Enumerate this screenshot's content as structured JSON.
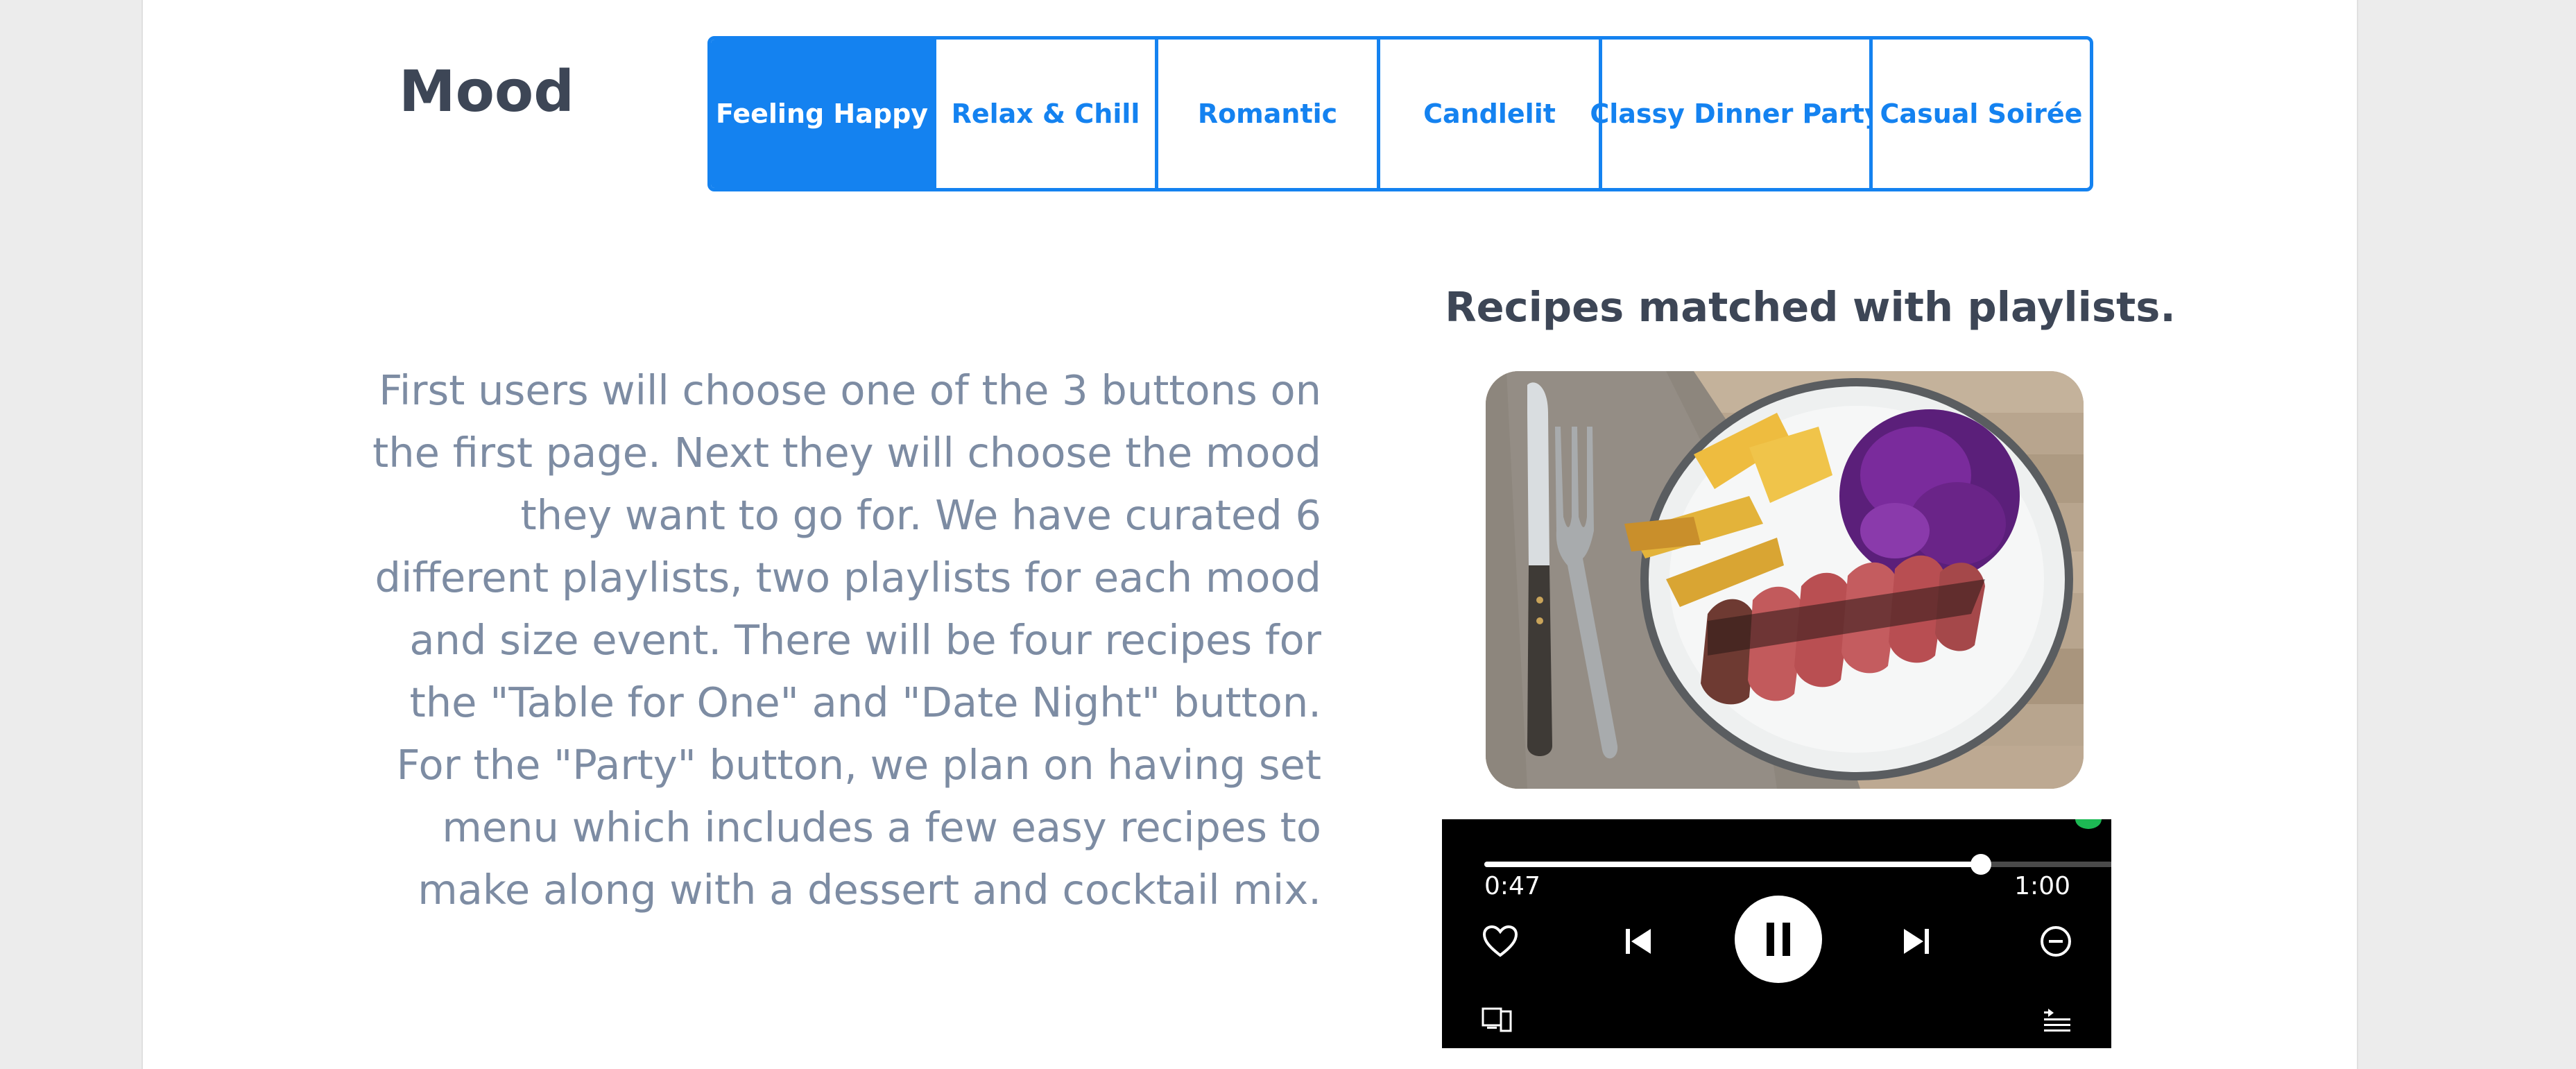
{
  "mood": {
    "title": "Mood",
    "tabs": [
      {
        "label": "Feeling Happy",
        "active": true
      },
      {
        "label": "Relax & Chill",
        "active": false
      },
      {
        "label": "Romantic",
        "active": false
      },
      {
        "label": "Candlelit",
        "active": false
      },
      {
        "label": "Classy Dinner Party",
        "active": false
      },
      {
        "label": "Casual Soirée",
        "active": false
      }
    ]
  },
  "description": "First users will choose one of the 3 buttons on the first page. Next they will choose the mood they want to go for. We have curated 6 different playlists, two playlists for each mood and size event. There will be four recipes for the \"Table for One\" and \"Date Night\" button. For the \"Party\" button, we plan on having set menu which includes a few easy recipes to make along with a dessert and cocktail mix.",
  "recipes": {
    "title": "Recipes matched with playlists.",
    "image_icon": "steak-dinner-plate-photo"
  },
  "player": {
    "elapsed": "0:47",
    "total": "1:00",
    "progress": 0.78,
    "state": "playing",
    "icons": [
      "heart-icon",
      "previous-icon",
      "pause-icon",
      "next-icon",
      "minus-circle-icon",
      "connect-device-icon",
      "queue-icon"
    ]
  },
  "colors": {
    "accent": "#1482f0",
    "title_text": "#3d4656",
    "body_text": "#7d8ca3",
    "page_bg": "#ececec",
    "player_bg": "#000000",
    "spotify_green": "#1db954"
  }
}
